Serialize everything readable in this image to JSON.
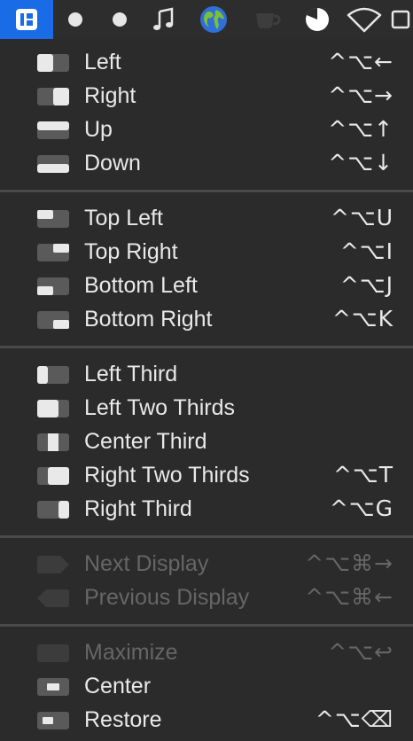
{
  "colors": {
    "menu_bg": "#2b2b2b",
    "menubar_bg": "#2d2d2d",
    "accent": "#1a6ce6",
    "text": "#e9e9e9",
    "text_disabled": "#666666",
    "separator": "#4a4a4a",
    "icon_dark": "#5a5a5a",
    "icon_light": "#e9e9e9"
  },
  "menubar": {
    "icons": [
      "rectangle-app-icon",
      "dot-icon",
      "dot-icon",
      "music-note-icon",
      "globe-icon",
      "coffee-cup-icon",
      "clock-icon",
      "wifi-icon",
      "square-icon"
    ]
  },
  "menu": {
    "groups": [
      [
        {
          "label": "Left",
          "shortcut": "^⌥←",
          "icon": "left-half-icon",
          "enabled": true
        },
        {
          "label": "Right",
          "shortcut": "^⌥→",
          "icon": "right-half-icon",
          "enabled": true
        },
        {
          "label": "Up",
          "shortcut": "^⌥↑",
          "icon": "top-half-icon",
          "enabled": true
        },
        {
          "label": "Down",
          "shortcut": "^⌥↓",
          "icon": "bottom-half-icon",
          "enabled": true
        }
      ],
      [
        {
          "label": "Top Left",
          "shortcut": "^⌥U",
          "icon": "top-left-icon",
          "enabled": true
        },
        {
          "label": "Top Right",
          "shortcut": "^⌥I",
          "icon": "top-right-icon",
          "enabled": true
        },
        {
          "label": "Bottom Left",
          "shortcut": "^⌥J",
          "icon": "bottom-left-icon",
          "enabled": true
        },
        {
          "label": "Bottom Right",
          "shortcut": "^⌥K",
          "icon": "bottom-right-icon",
          "enabled": true
        }
      ],
      [
        {
          "label": "Left Third",
          "shortcut": "",
          "icon": "left-third-icon",
          "enabled": true
        },
        {
          "label": "Left Two Thirds",
          "shortcut": "",
          "icon": "left-two-thirds-icon",
          "enabled": true
        },
        {
          "label": "Center Third",
          "shortcut": "",
          "icon": "center-third-icon",
          "enabled": true
        },
        {
          "label": "Right Two Thirds",
          "shortcut": "^⌥T",
          "icon": "right-two-thirds-icon",
          "enabled": true
        },
        {
          "label": "Right Third",
          "shortcut": "^⌥G",
          "icon": "right-third-icon",
          "enabled": true
        }
      ],
      [
        {
          "label": "Next Display",
          "shortcut": "^⌥⌘→",
          "icon": "next-display-icon",
          "enabled": false
        },
        {
          "label": "Previous Display",
          "shortcut": "^⌥⌘←",
          "icon": "previous-display-icon",
          "enabled": false
        }
      ],
      [
        {
          "label": "Maximize",
          "shortcut": "^⌥↩",
          "icon": "maximize-icon",
          "enabled": false
        },
        {
          "label": "Center",
          "shortcut": "",
          "icon": "center-icon",
          "enabled": true
        },
        {
          "label": "Restore",
          "shortcut": "^⌥⌫",
          "icon": "restore-icon",
          "enabled": true
        }
      ]
    ]
  }
}
